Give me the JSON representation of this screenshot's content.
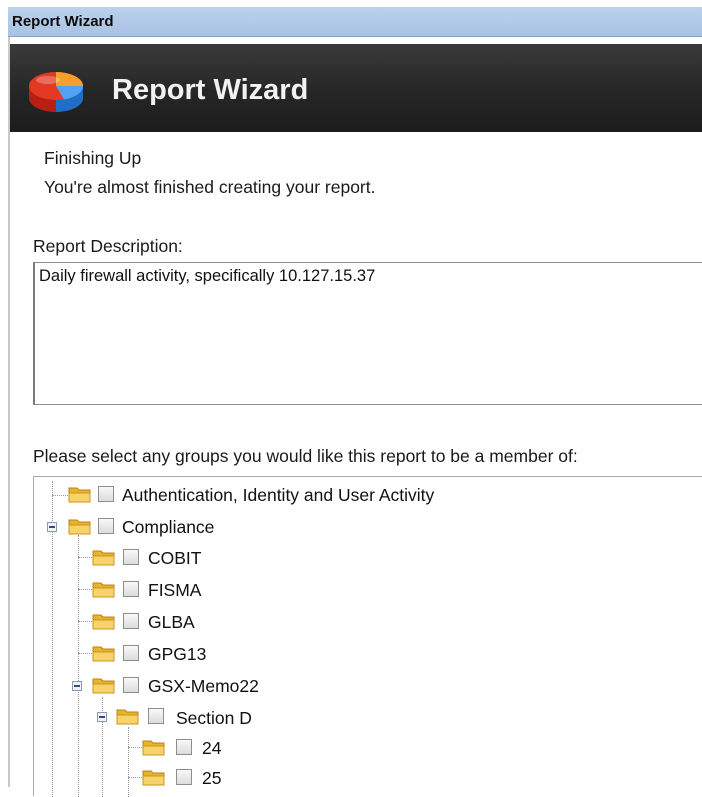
{
  "window": {
    "title": "Report Wizard"
  },
  "header": {
    "title": "Report Wizard",
    "logo_icon": "pie-chart-icon"
  },
  "step": {
    "title": "Finishing Up",
    "subtitle": "You're almost finished creating your report."
  },
  "description": {
    "label": "Report Description:",
    "value": "Daily firewall activity, specifically 10.127.15.37"
  },
  "groups": {
    "prompt": "Please select any groups you would like this report to be a member of:",
    "items": [
      {
        "label": "Authentication, Identity and User Activity",
        "checked": false,
        "expanded": false
      },
      {
        "label": "Compliance",
        "checked": false,
        "expanded": true
      },
      {
        "label": "COBIT",
        "checked": false
      },
      {
        "label": "FISMA",
        "checked": false
      },
      {
        "label": "GLBA",
        "checked": false
      },
      {
        "label": "GPG13",
        "checked": false
      },
      {
        "label": "GSX-Memo22",
        "checked": false,
        "expanded": true
      },
      {
        "label": "Section D",
        "checked": false,
        "expanded": true
      },
      {
        "label": "24",
        "checked": false
      },
      {
        "label": "25",
        "checked": false
      }
    ]
  },
  "colors": {
    "titlebar": "#b3cbe9",
    "header": "#2a2a2a",
    "folder": "#f3c33c"
  }
}
